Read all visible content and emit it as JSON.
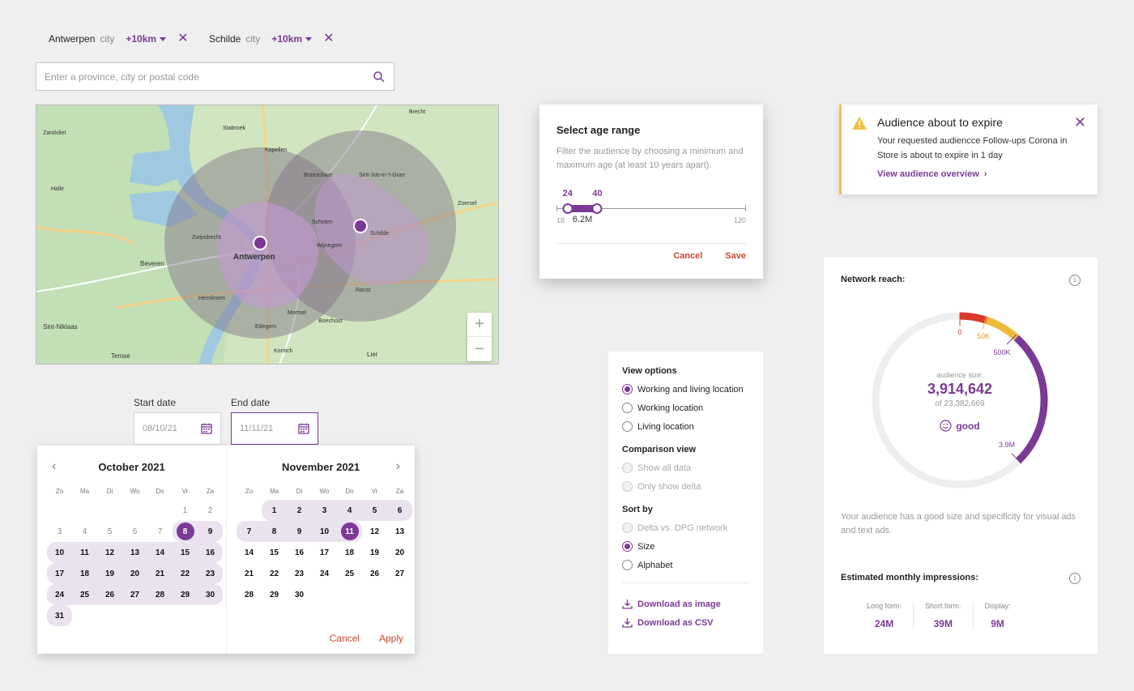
{
  "locations": [
    {
      "city": "Antwerpen",
      "type": "city",
      "radius": "+10km"
    },
    {
      "city": "Schilde",
      "type": "city",
      "radius": "+10km"
    }
  ],
  "search": {
    "placeholder": "Enter a province, city or postal code"
  },
  "map": {
    "labels": [
      "Antwerpen",
      "Schilde",
      "Beveren",
      "Kapellen",
      "Brasschaat",
      "Mortsel",
      "Edegem",
      "Wijnegem",
      "Schoten",
      "Ranst",
      "Boechout",
      "Kontich",
      "Lier",
      "Sint-Niklaas",
      "Temse",
      "Stabroek",
      "Zoersel",
      "Brecht",
      "Hemiksem",
      "Zwijndrecht",
      "Sint-Job-in-'t-Goor",
      "Halle",
      "Zandvliet"
    ],
    "zoom_in": "+",
    "zoom_out": "−"
  },
  "dates": {
    "start_label": "Start date",
    "start_value": "08/10/21",
    "end_label": "End date",
    "end_value": "11/11/21"
  },
  "calendar": {
    "dow": [
      "Zo",
      "Ma",
      "Di",
      "Wo",
      "Do",
      "Vr",
      "Za"
    ],
    "months": [
      {
        "title": "October 2021",
        "offset": 5,
        "days": 31,
        "prev_muted_to": 7,
        "range_start": 8,
        "range_end": 31
      },
      {
        "title": "November 2021",
        "offset": 1,
        "days": 30,
        "range_start": 1,
        "range_end": 11
      }
    ],
    "cancel": "Cancel",
    "apply": "Apply"
  },
  "age_modal": {
    "title": "Select age range",
    "description": "Filter the audience by choosing a minimum and maximum age (at least 10 years apart).",
    "min": 18,
    "max": 120,
    "low": 24,
    "high": 40,
    "reach": "6.2M",
    "cancel": "Cancel",
    "save": "Save"
  },
  "view_options": {
    "heading": "View options",
    "items": [
      "Working and living location",
      "Working location",
      "Living location"
    ],
    "comparison_heading": "Comparison view",
    "comparison_items": [
      "Show all data",
      "Only show delta"
    ],
    "sort_heading": "Sort by",
    "sort_items": [
      "Delta vs. DPG network",
      "Size",
      "Alphabet"
    ],
    "download_image": "Download as image",
    "download_csv": "Download as CSV"
  },
  "alert": {
    "title": "Audience about to expire",
    "body": "Your requested audiencce Follow-ups Corona in Store is about to expire in 1 day",
    "link": "View audience overview"
  },
  "reach": {
    "title": "Network reach:",
    "size_label": "audience size:",
    "size_value": "3,914,642",
    "total": "of 23,382,669",
    "rating": "good",
    "ticks": [
      "0",
      "50K",
      "500K",
      "3.9M"
    ],
    "description": "Your audience has a good size and specificity for visual ads and text ads.",
    "impressions_title": "Estimated monthly impressions:",
    "impressions": [
      {
        "label": "Long form:",
        "value": "24M"
      },
      {
        "label": "Short form:",
        "value": "39M"
      },
      {
        "label": "Display:",
        "value": "9M"
      }
    ]
  },
  "colors": {
    "accent": "#7b3a96",
    "danger": "#c8472e",
    "warning": "#f0c040",
    "good": "#d93a2b"
  }
}
